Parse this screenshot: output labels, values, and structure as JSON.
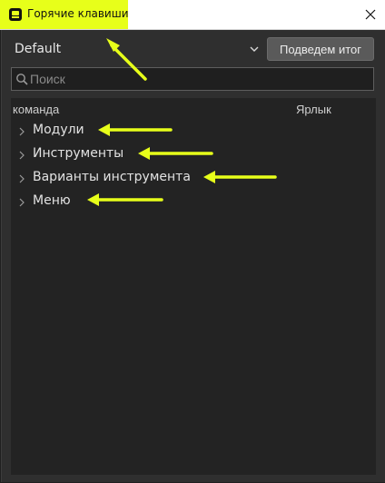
{
  "window": {
    "title": "Горячие клавиши",
    "highlight_color": "#e7ff1a"
  },
  "toolbar": {
    "preset_value": "Default",
    "summary_button_label": "Подведем итог"
  },
  "search": {
    "placeholder": "Поиск"
  },
  "table": {
    "column_command": "команда",
    "column_shortcut": "Ярлык",
    "items": [
      {
        "label": "Модули"
      },
      {
        "label": "Инструменты"
      },
      {
        "label": "Варианты инструмента"
      },
      {
        "label": "Меню"
      }
    ]
  },
  "annotations": {
    "arrow_color": "#e7ff1a"
  }
}
